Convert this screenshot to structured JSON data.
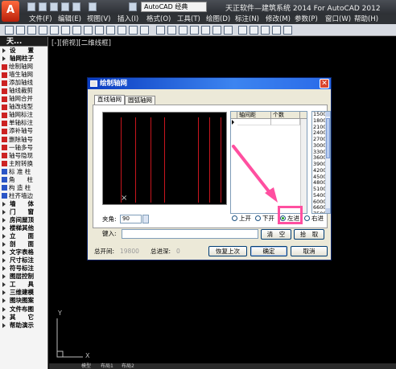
{
  "app": {
    "title": "天正软件—建筑系统 2014  For AutoCAD 2012",
    "workspace": "AutoCAD 经典",
    "view_label": "[-][俯视][二维线框]",
    "app_button": "A"
  },
  "menu": [
    "文件(F)",
    "编辑(E)",
    "视图(V)",
    "插入(I)",
    "格式(O)",
    "工具(T)",
    "绘图(D)",
    "标注(N)",
    "修改(M)",
    "参数(P)",
    "窗口(W)",
    "帮助(H)"
  ],
  "sidebar": {
    "header": "天...",
    "items": [
      {
        "label": "设　　置",
        "section": true
      },
      {
        "label": "轴网柱子",
        "section": true
      },
      {
        "label": "绘制轴网"
      },
      {
        "label": "墙生轴网"
      },
      {
        "label": "添加轴线"
      },
      {
        "label": "轴线裁剪"
      },
      {
        "label": "轴网合并"
      },
      {
        "label": "轴改线型"
      },
      {
        "label": "轴网标注"
      },
      {
        "label": "单轴标注"
      },
      {
        "label": "添补轴号"
      },
      {
        "label": "删除轴号"
      },
      {
        "label": "一轴多号"
      },
      {
        "label": "轴号隐现"
      },
      {
        "label": "主附转换"
      },
      {
        "label": "标 准 柱",
        "blue": true
      },
      {
        "label": "角　　柱",
        "blue": true
      },
      {
        "label": "构 造 柱",
        "blue": true
      },
      {
        "label": "柱齐墙边",
        "blue": true
      },
      {
        "label": "墙　　体",
        "section": true
      },
      {
        "label": "门　　窗",
        "section": true
      },
      {
        "label": "房间屋顶",
        "section": true
      },
      {
        "label": "楼梯其他",
        "section": true
      },
      {
        "label": "立　　面",
        "section": true
      },
      {
        "label": "剖　　面",
        "section": true
      },
      {
        "label": "文字表格",
        "section": true
      },
      {
        "label": "尺寸标注",
        "section": true
      },
      {
        "label": "符号标注",
        "section": true
      },
      {
        "label": "图层控制",
        "section": true
      },
      {
        "label": "工　　具",
        "section": true
      },
      {
        "label": "三维建模",
        "section": true
      },
      {
        "label": "图块图案",
        "section": true
      },
      {
        "label": "文件布图",
        "section": true
      },
      {
        "label": "其　　它",
        "section": true
      },
      {
        "label": "帮助演示",
        "section": true
      }
    ]
  },
  "dialog": {
    "title": "绘制轴网",
    "tabs": [
      "直线轴网",
      "圆弧轴网"
    ],
    "grid_headers": [
      "轴间距",
      "个数"
    ],
    "spacing_values": [
      "1500",
      "1800",
      "2100",
      "2400",
      "2700",
      "3000",
      "3300",
      "3600",
      "3900",
      "4200",
      "4500",
      "4800",
      "5100",
      "5400",
      "6000",
      "6600",
      "7500",
      "9000"
    ],
    "angle_label": "夹角:",
    "angle_value": "90",
    "keyin_label": "键入:",
    "keyin_value": "",
    "radio": {
      "up": "上开",
      "down": "下开",
      "left": "左进",
      "right": "右进",
      "selected": "left"
    },
    "clear_button": "清　空",
    "pick_button": "拾　取",
    "total_width_label": "总开间:",
    "total_width_value": "19800",
    "total_depth_label": "总进深:",
    "total_depth_value": "0",
    "restore_button": "恢复上次",
    "ok_button": "确定",
    "cancel_button": "取消"
  },
  "bottom_tabs": [
    "模型",
    "布局1",
    "布局2"
  ],
  "colors": {
    "axis_line": "#c8161e",
    "annotation": "#ff4fa0",
    "dialog_title": "#0a3cc0"
  }
}
